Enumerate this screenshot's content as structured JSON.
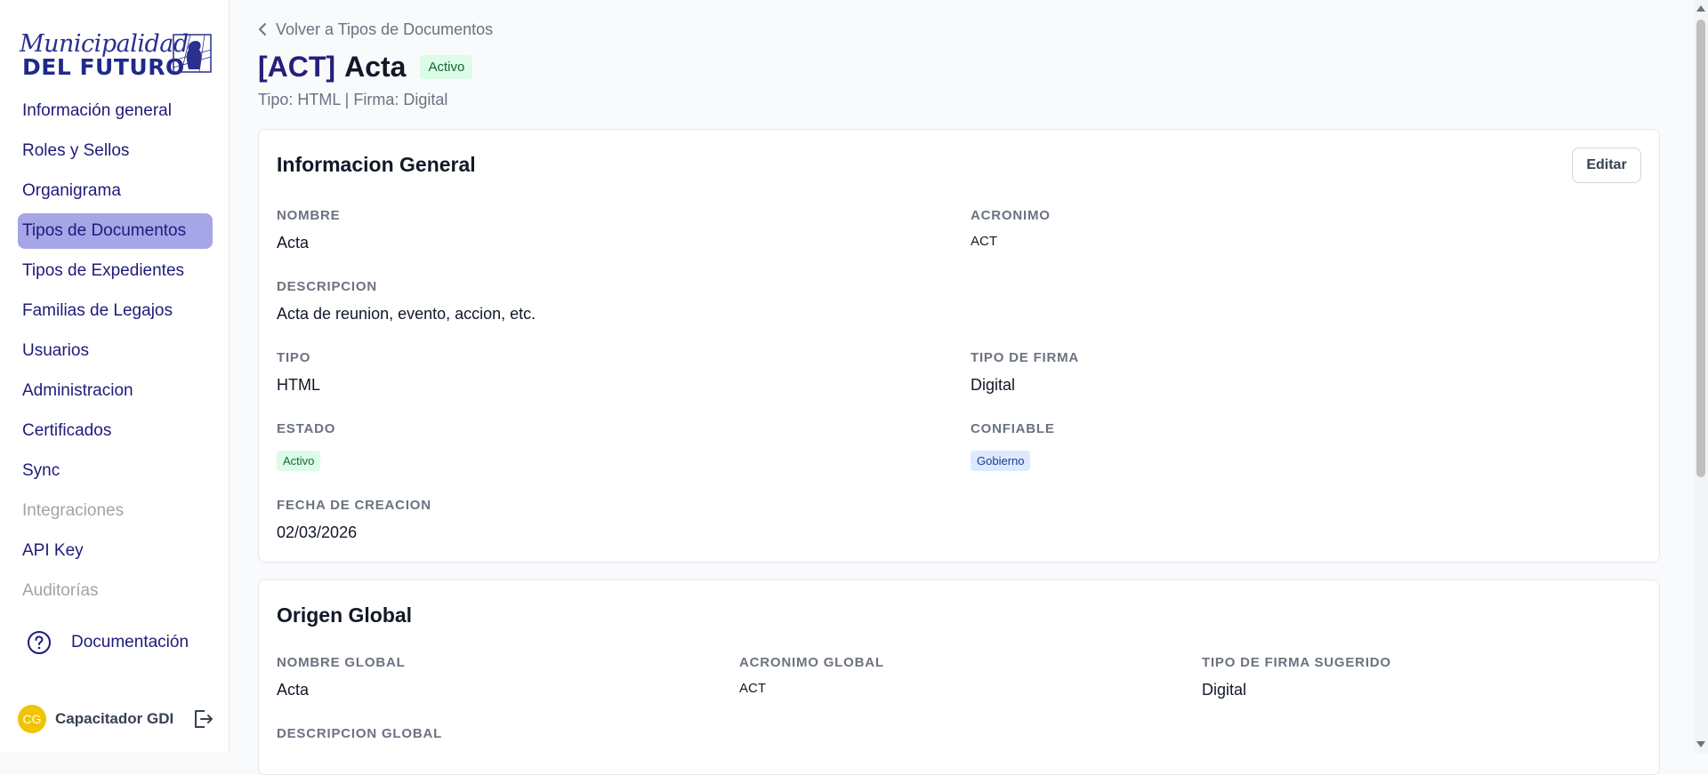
{
  "brand": {
    "script": "Municipalidad",
    "bold": "DEL FUTURO"
  },
  "sidebar": {
    "items": [
      {
        "label": "Información general"
      },
      {
        "label": "Roles y Sellos"
      },
      {
        "label": "Organigrama"
      },
      {
        "label": "Tipos de Documentos"
      },
      {
        "label": "Tipos de Expedientes"
      },
      {
        "label": "Familias de Legajos"
      },
      {
        "label": "Usuarios"
      },
      {
        "label": "Administracion"
      },
      {
        "label": "Certificados"
      },
      {
        "label": "Sync"
      },
      {
        "label": "Integraciones"
      },
      {
        "label": "API Key"
      },
      {
        "label": "Auditorías"
      }
    ],
    "docs_label": "Documentación",
    "user": {
      "initials": "CG",
      "name": "Capacitador GDI"
    }
  },
  "header": {
    "back_label": "Volver a Tipos de Documentos",
    "acronym": "[ACT]",
    "name": "Acta",
    "status": "Activo",
    "subtitle": "Tipo: HTML | Firma: Digital"
  },
  "general": {
    "title": "Informacion General",
    "edit_label": "Editar",
    "nombre_label": "NOMBRE",
    "nombre": "Acta",
    "acronimo_label": "ACRONIMO",
    "acronimo": "ACT",
    "descripcion_label": "DESCRIPCION",
    "descripcion": "Acta de reunion, evento, accion, etc.",
    "tipo_label": "TIPO",
    "tipo": "HTML",
    "tipo_firma_label": "TIPO DE FIRMA",
    "tipo_firma": "Digital",
    "estado_label": "ESTADO",
    "estado": "Activo",
    "confiable_label": "CONFIABLE",
    "confiable": "Gobierno",
    "fecha_label": "FECHA DE CREACION",
    "fecha": "02/03/2026"
  },
  "global": {
    "title": "Origen Global",
    "nombre_label": "NOMBRE GLOBAL",
    "nombre": "Acta",
    "acronimo_label": "ACRONIMO GLOBAL",
    "acronimo": "ACT",
    "firma_label": "TIPO DE FIRMA SUGERIDO",
    "firma": "Digital",
    "descripcion_label": "DESCRIPCION GLOBAL"
  },
  "colors": {
    "accent": "#1e1b7a",
    "active_bg": "#a5a5e8",
    "success_bg": "#dcfce7",
    "info_bg": "#dbeafe"
  }
}
